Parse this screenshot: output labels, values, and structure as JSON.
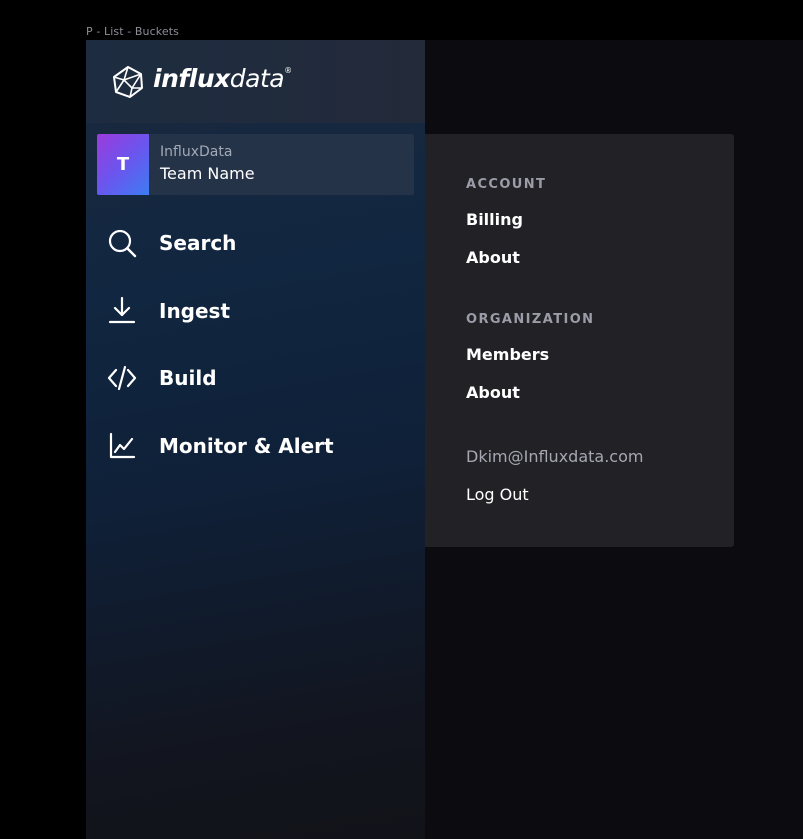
{
  "frame_label": "P - List - Buckets",
  "brand": {
    "name_bold": "influx",
    "name_light": "data",
    "trademark": "®"
  },
  "team": {
    "initial": "T",
    "org": "InfluxData",
    "name": "Team Name"
  },
  "nav": [
    {
      "label": "Search",
      "icon": "search-icon"
    },
    {
      "label": "Ingest",
      "icon": "download-icon"
    },
    {
      "label": "Build",
      "icon": "code-icon"
    },
    {
      "label": "Monitor & Alert",
      "icon": "chart-icon"
    }
  ],
  "menu": {
    "account_heading": "ACCOUNT",
    "account_links": [
      "Billing",
      "About"
    ],
    "org_heading": "ORGANIZATION",
    "org_links": [
      "Members",
      "About"
    ],
    "email": "Dkim@Influxdata.com",
    "logout": "Log Out"
  },
  "colors": {
    "sidebar": "#112640",
    "menu_bg": "#212126",
    "avatar_start": "#9b3bdc",
    "avatar_end": "#3d7cf2"
  }
}
